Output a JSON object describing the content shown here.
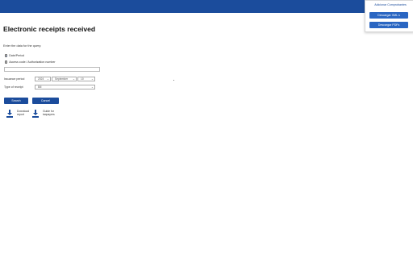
{
  "popup": {
    "title": "Adicionar Comprobantes",
    "button_xml": "Descargar XML s",
    "button_pdf": "Descargar PDFs"
  },
  "page": {
    "title": "Electronic receipts received",
    "instruction": "Enter the data for the query:"
  },
  "query_options": {
    "radio_date": "Date/Period",
    "radio_access": "Access code / Authorization number"
  },
  "access_code": {
    "value": ""
  },
  "issuance_period": {
    "label": "Issuance period",
    "year": "2024",
    "month": "September",
    "day": "10"
  },
  "receipt_type": {
    "label": "Type of receipt",
    "value": "Bill"
  },
  "actions": {
    "search": "Search",
    "cancel": "Cancel"
  },
  "downloads": [
    {
      "label": "Download report",
      "line1": "Download",
      "line2": "report"
    },
    {
      "label": "Guide for taxpayers",
      "line1": "Guide for",
      "line2": "taxpayers"
    }
  ],
  "colors": {
    "header_bar": "#1b4c9c",
    "primary_button": "#1b4c9c",
    "popup_button": "#2a66c2"
  }
}
